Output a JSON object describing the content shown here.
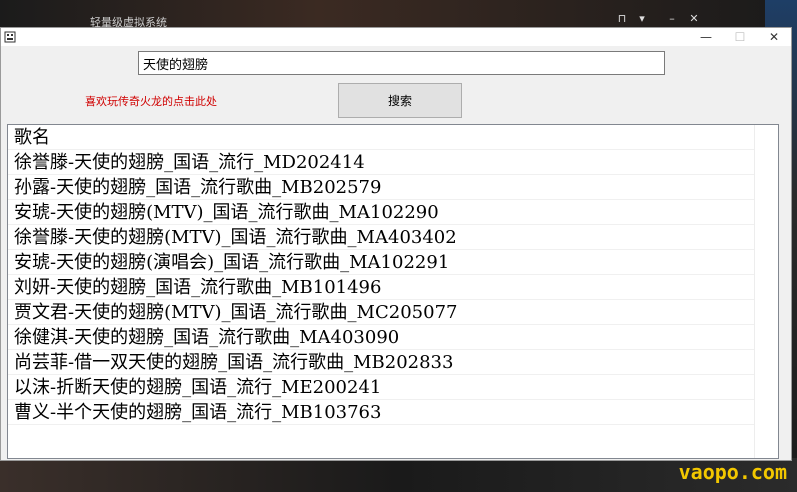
{
  "background": {
    "window_title": "轻量级虚拟系统"
  },
  "watermark": "vaopo.com",
  "window": {
    "controls": {
      "minimize": "—",
      "maximize": "☐",
      "close": "✕"
    }
  },
  "search": {
    "value": "天使的翅膀",
    "button_label": "搜索"
  },
  "promo_link": "喜欢玩传奇火龙的点击此处",
  "list": {
    "header": "歌名",
    "rows": [
      "徐誉滕-天使的翅膀_国语_流行_MD202414",
      "孙露-天使的翅膀_国语_流行歌曲_MB202579",
      "安琥-天使的翅膀(MTV)_国语_流行歌曲_MA102290",
      "徐誉滕-天使的翅膀(MTV)_国语_流行歌曲_MA403402",
      "安琥-天使的翅膀(演唱会)_国语_流行歌曲_MA102291",
      "刘妍-天使的翅膀_国语_流行歌曲_MB101496",
      "贾文君-天使的翅膀(MTV)_国语_流行歌曲_MC205077",
      "徐健淇-天使的翅膀_国语_流行歌曲_MA403090",
      "尚芸菲-借一双天使的翅膀_国语_流行歌曲_MB202833",
      "以沫-折断天使的翅膀_国语_流行_ME200241",
      "曹义-半个天使的翅膀_国语_流行_MB103763"
    ]
  }
}
